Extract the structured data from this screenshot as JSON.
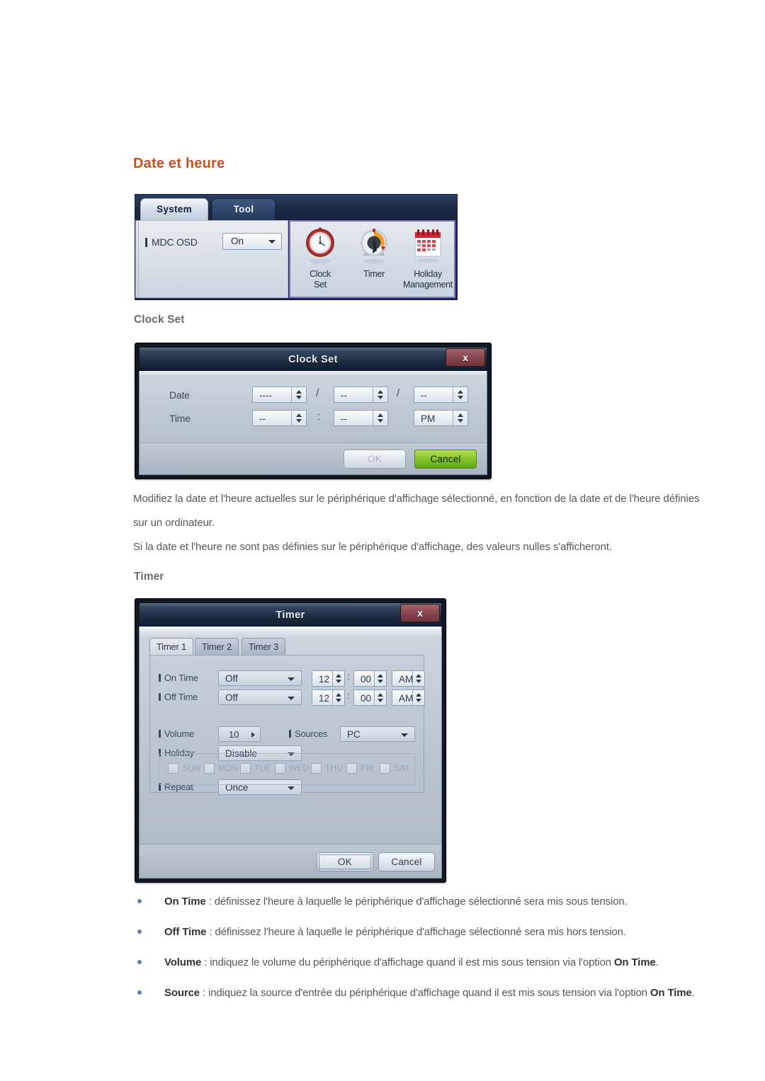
{
  "section": {
    "heading": "Date et heure"
  },
  "mdc_panel": {
    "tabs": [
      {
        "label": "System",
        "active": true
      },
      {
        "label": "Tool",
        "active": false
      }
    ],
    "osd_label": "MDC OSD",
    "osd_value": "On",
    "icons": [
      {
        "name": "clock-set-icon",
        "caption_line1": "Clock",
        "caption_line2": "Set"
      },
      {
        "name": "timer-icon",
        "caption_line1": "Timer",
        "caption_line2": ""
      },
      {
        "name": "holiday-management-icon",
        "caption_line1": "Holiday",
        "caption_line2": "Management"
      }
    ],
    "selection_border_color": "#7a74c8"
  },
  "clock_set": {
    "subtitle": "Clock Set",
    "dialog_title": "Clock Set",
    "close_label": "x",
    "rows": [
      {
        "label": "Date",
        "fields": [
          {
            "value": "----",
            "sep_after": "/"
          },
          {
            "value": "--",
            "sep_after": "/"
          },
          {
            "value": "--",
            "sep_after": ""
          }
        ]
      },
      {
        "label": "Time",
        "fields": [
          {
            "value": "--",
            "sep_after": ":"
          },
          {
            "value": "--",
            "sep_after": ""
          },
          {
            "value": "PM",
            "sep_after": ""
          }
        ]
      }
    ],
    "ok_label": "OK",
    "cancel_label": "Cancel"
  },
  "paragraphs": [
    "Modifiez la date et l'heure actuelles sur le périphérique d'affichage sélectionné, en fonction de la date et de l'heure définies sur un ordinateur.",
    "Si la date et l'heure ne sont pas définies sur le périphérique d'affichage, des valeurs nulles s'afficheront."
  ],
  "timer": {
    "subtitle": "Timer",
    "dialog_title": "Timer",
    "close_label": "x",
    "tabs": [
      {
        "label": "Timer 1",
        "active": true
      },
      {
        "label": "Timer 2",
        "active": false
      },
      {
        "label": "Timer 3",
        "active": false
      }
    ],
    "on_time": {
      "label": "On Time",
      "state": "Off",
      "hour": "12",
      "minute": "00",
      "meridiem": "AM"
    },
    "off_time": {
      "label": "Off Time",
      "state": "Off",
      "hour": "12",
      "minute": "00",
      "meridiem": "AM"
    },
    "volume": {
      "label": "Volume",
      "value": "10"
    },
    "sources": {
      "label": "Sources",
      "value": "PC"
    },
    "holiday": {
      "label": "Holiday",
      "value": "Disable"
    },
    "repeat": {
      "label": "Repeat",
      "value": "Once"
    },
    "days": [
      "SUN",
      "MON",
      "TUE",
      "WED",
      "THU",
      "FRI",
      "SAT"
    ],
    "ok_label": "OK",
    "cancel_label": "Cancel"
  },
  "bullets": [
    {
      "term": "On Time",
      "rest": " : définissez l'heure à laquelle le périphérique d'affichage sélectionné sera mis sous tension."
    },
    {
      "term": "Off Time",
      "rest": " : définissez l'heure à laquelle le périphérique d'affichage sélectionné sera mis hors tension."
    },
    {
      "term": "Volume",
      "rest": " : indiquez le volume du périphérique d'affichage quand il est mis sous tension via l'option ",
      "term2": "On Time",
      "rest2": "."
    },
    {
      "term": "Source",
      "rest": " : indiquez la source d'entrée du périphérique d'affichage quand il est mis sous tension via l'option ",
      "term2": "On Time",
      "rest2": "."
    }
  ]
}
